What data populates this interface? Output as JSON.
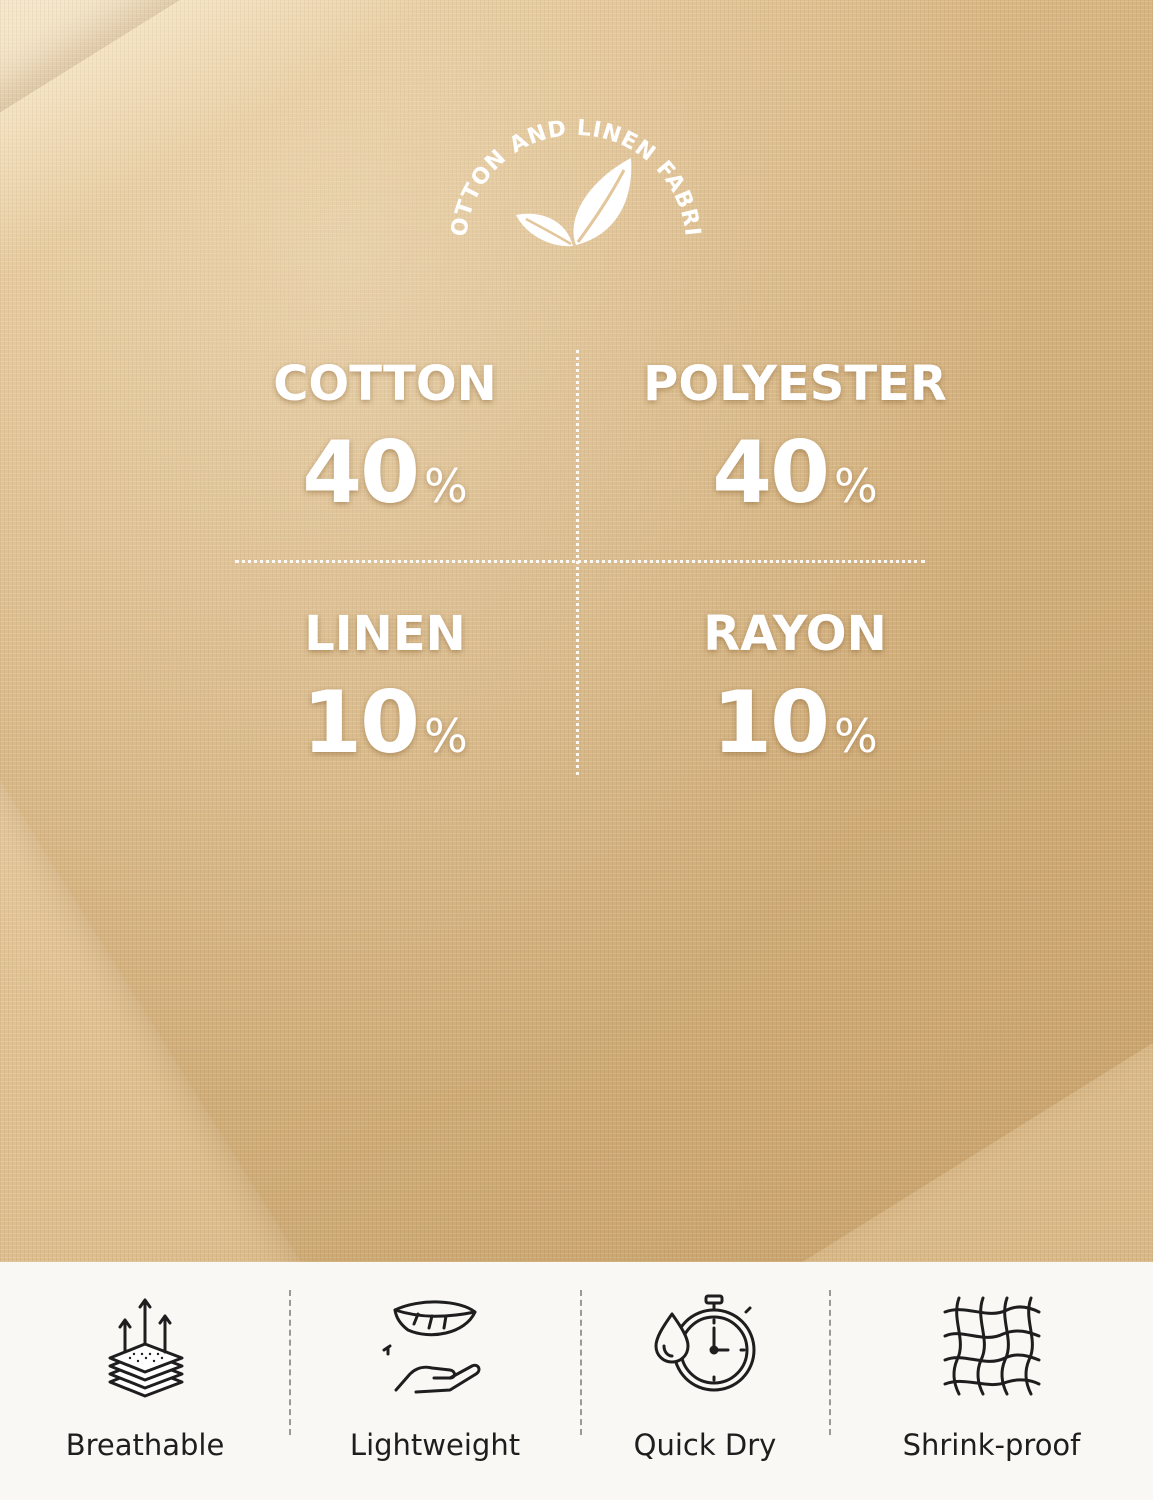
{
  "badge": {
    "text": "COTTON AND LINEN FABRIC",
    "icon": "leaf-icon"
  },
  "composition": [
    {
      "material": "COTTON",
      "percent": "40",
      "unit": "%"
    },
    {
      "material": "POLYESTER",
      "percent": "40",
      "unit": "%"
    },
    {
      "material": "LINEN",
      "percent": "10",
      "unit": "%"
    },
    {
      "material": "RAYON",
      "percent": "10",
      "unit": "%"
    }
  ],
  "features": [
    {
      "label": "Breathable",
      "icon": "breathable-layers-icon"
    },
    {
      "label": "Lightweight",
      "icon": "feather-hand-icon"
    },
    {
      "label": "Quick Dry",
      "icon": "droplet-stopwatch-icon"
    },
    {
      "label": "Shrink-proof",
      "icon": "mesh-net-icon"
    }
  ],
  "colors": {
    "fabric": "#e3c69b",
    "text_on_fabric": "#ffffff",
    "feature_bar": "#f9f8f5",
    "feature_text": "#1e1e1e"
  }
}
